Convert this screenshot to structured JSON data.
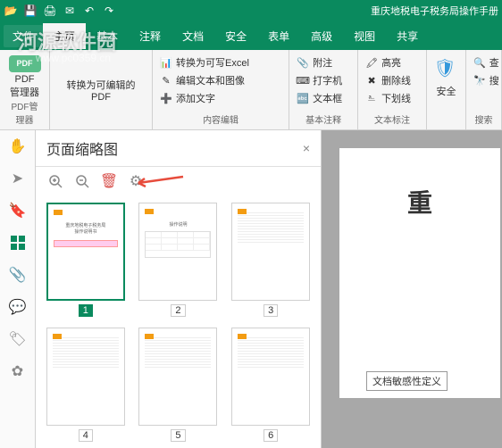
{
  "titlebar": {
    "title": "重庆地税电子税务局操作手册"
  },
  "menubar": {
    "file": "文件",
    "items": [
      "主页",
      "基本",
      "注释",
      "文档",
      "安全",
      "表单",
      "高级",
      "视图",
      "共享"
    ]
  },
  "ribbon": {
    "pdf_manager": {
      "label1": "PDF",
      "label2": "管理器",
      "group": "PDF管理器"
    },
    "convert": {
      "label": "转换为可编辑的PDF",
      "excel": "转换为可写Excel",
      "edit_text": "编辑文本和图像",
      "add_text": "添加文字",
      "group": "内容编辑"
    },
    "basic_annot": {
      "attach": "附注",
      "typewriter": "打字机",
      "textbox": "文本框",
      "group": "基本注释"
    },
    "text_mark": {
      "highlight": "高亮",
      "strikeout": "删除线",
      "underline": "下划线",
      "group": "文本标注"
    },
    "security": {
      "label": "安全"
    },
    "search": {
      "find": "查",
      "search": "搜",
      "group": "搜索"
    }
  },
  "panel": {
    "title": "页面缩略图"
  },
  "thumbnails": {
    "pages": [
      1,
      2,
      3,
      4,
      5,
      6
    ],
    "selected": 1
  },
  "doc": {
    "preview_char": "重",
    "sensitive": "文档敏感性定义"
  },
  "watermark": {
    "text": "河源软件园",
    "url": "www.pc0359.cn"
  }
}
